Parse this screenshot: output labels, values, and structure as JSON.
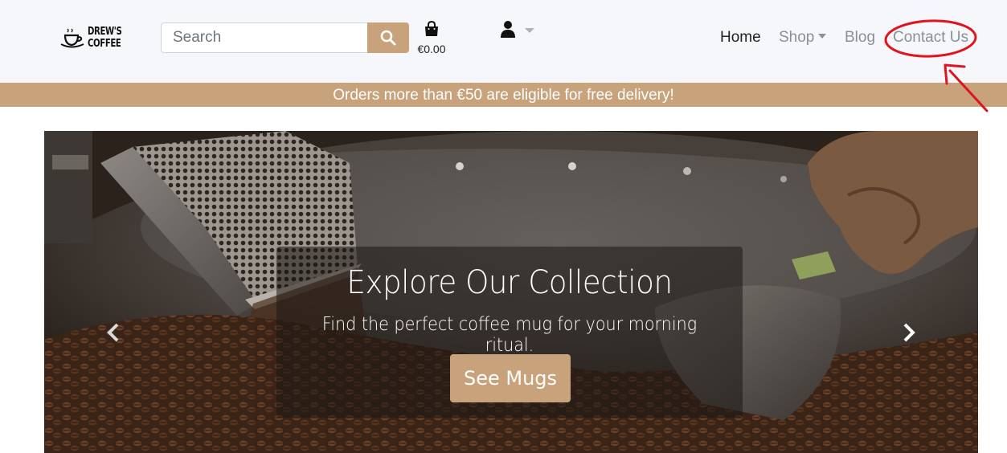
{
  "brand": {
    "name_line1": "DREW'S",
    "name_line2": "COFFEE",
    "logo_icon": "coffee-cup-icon"
  },
  "search": {
    "placeholder": "Search",
    "value": "",
    "button_icon": "search-icon"
  },
  "cart": {
    "icon": "shopping-bag-icon",
    "total": "€0.00"
  },
  "account": {
    "icon": "user-icon",
    "dropdown_icon": "caret-down-icon"
  },
  "nav": {
    "home": "Home",
    "shop": "Shop",
    "blog": "Blog",
    "contact": "Contact Us",
    "active": "Home"
  },
  "promo": {
    "text": "Orders more than €50 are eligible for free delivery!"
  },
  "carousel": {
    "title": "Explore Our Collection",
    "subtitle": "Find the perfect coffee mug for your morning ritual.",
    "button": "See Mugs",
    "prev_icon": "chevron-left-icon",
    "next_icon": "chevron-right-icon"
  },
  "colors": {
    "accent": "#c8a27a",
    "navbar_bg": "#f5f7fa",
    "annotation": "#e0141e"
  }
}
